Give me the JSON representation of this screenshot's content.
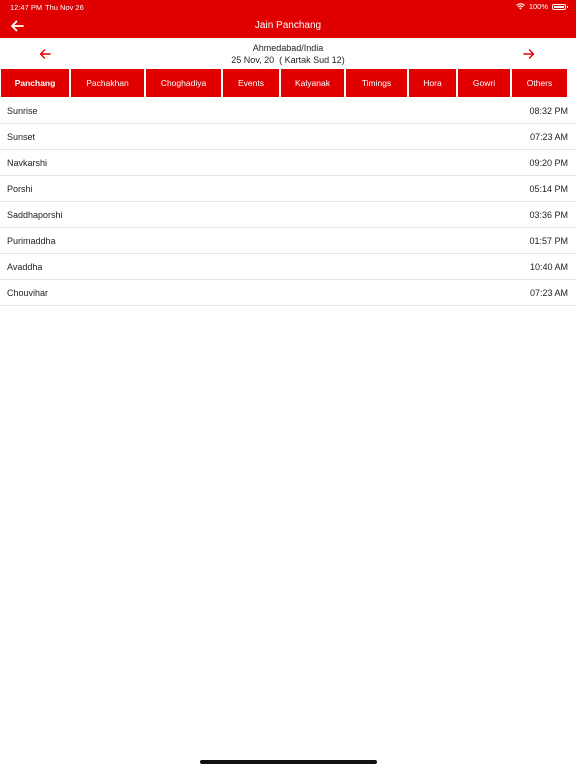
{
  "status_bar": {
    "time": "12:47 PM",
    "date": "Thu Nov 26",
    "battery": "100%"
  },
  "header": {
    "title": "Jain Panchang",
    "accent": "#e00000"
  },
  "date_bar": {
    "location": "Ahmedabad/India",
    "date_text": "25 Nov, 20  ( Kartak Sud 12)"
  },
  "tabs": [
    {
      "label": "Panchang",
      "active": true
    },
    {
      "label": "Pachakhan"
    },
    {
      "label": "Choghadiya"
    },
    {
      "label": "Events"
    },
    {
      "label": "Kalyanak"
    },
    {
      "label": "Timings"
    },
    {
      "label": "Hora"
    },
    {
      "label": "Gowri"
    },
    {
      "label": "Others"
    }
  ],
  "rows": [
    {
      "label": "Sunrise",
      "value": "08:32 PM"
    },
    {
      "label": "Sunset",
      "value": "07:23 AM"
    },
    {
      "label": "Navkarshi",
      "value": "09:20 PM"
    },
    {
      "label": "Porshi",
      "value": "05:14 PM"
    },
    {
      "label": "Saddhaporshi",
      "value": "03:36 PM"
    },
    {
      "label": "Purimaddha",
      "value": "01:57 PM"
    },
    {
      "label": "Avaddha",
      "value": "10:40 AM"
    },
    {
      "label": "Chouvihar",
      "value": "07:23 AM"
    }
  ]
}
